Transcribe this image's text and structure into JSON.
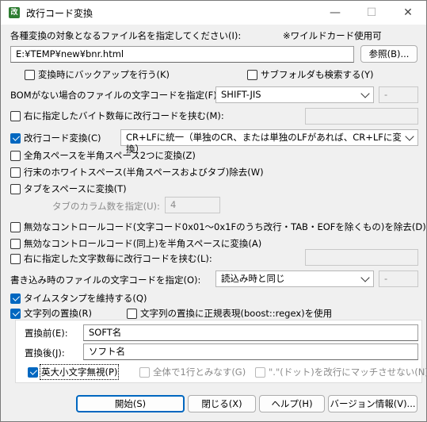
{
  "window": {
    "title": "改行コード変換",
    "icon_text": "改",
    "minimize": "—",
    "maximize": "☐",
    "close": "✕"
  },
  "files": {
    "label": "各種変換の対象となるファイル名を指定してください(I):",
    "wildcard_note": "※ワイルドカード使用可",
    "path_value": "E:¥TEMP¥new¥bnr.html",
    "browse_label": "参照(B)..."
  },
  "options": {
    "backup_label": "変換時にバックアップを行う(K)",
    "backup_checked": false,
    "subfolder_label": "サブフォルダも検索する(Y)",
    "subfolder_checked": false,
    "bom_label": "BOMがない場合のファイルの文字コードを指定(F):",
    "bom_value": "SHIFT-JIS",
    "bom_side_value": "-",
    "insert_bytes_label": "右に指定したバイト数毎に改行コードを挟む(M):",
    "insert_bytes_checked": false,
    "newline_label": "改行コード変換(C)",
    "newline_checked": true,
    "newline_value": "CR+LFに統一（単独のCR、または単独のLFがあれば、CR+LFに変換）",
    "zenkaku_label": "全角スペースを半角スペース2つに変換(Z)",
    "zenkaku_checked": false,
    "trailing_ws_label": "行末のホワイトスペース(半角スペースおよびタブ)除去(W)",
    "trailing_ws_checked": false,
    "tab_label": "タブをスペースに変換(T)",
    "tab_checked": false,
    "tab_width_label": "タブのカラム数を指定(U):",
    "tab_width_value": "4",
    "ctrl_remove_label": "無効なコントロールコード(文字コード0x01〜0x1Fのうち改行・TAB・EOFを除くもの)を除去(D)",
    "ctrl_remove_checked": false,
    "ctrl_space_label": "無効なコントロールコード(同上)を半角スペースに変換(A)",
    "ctrl_space_checked": false,
    "insert_chars_label": "右に指定した文字数毎に改行コードを挟む(L):",
    "insert_chars_checked": false,
    "write_enc_label": "書き込み時のファイルの文字コードを指定(O):",
    "write_enc_value": "読込み時と同じ",
    "write_enc_side_value": "-",
    "timestamp_label": "タイムスタンプを維持する(Q)",
    "timestamp_checked": true,
    "replace_label": "文字列の置換(R)",
    "replace_checked": true,
    "regex_label": "文字列の置換に正規表現(boost::regex)を使用",
    "regex_checked": false
  },
  "replace": {
    "before_label": "置換前(E):",
    "before_value": "SOFT名",
    "after_label": "置換後(J):",
    "after_value": "ソフト名",
    "ignore_case_label": "英大小文字無視(P)",
    "ignore_case_checked": true,
    "whole_line_label": "全体で1行とみなす(G)",
    "whole_line_checked": false,
    "dot_newline_label": "\".\"(ドット)を改行にマッチさせない(N)",
    "dot_newline_checked": false
  },
  "buttons": {
    "start": "開始(S)",
    "close": "閉じる(X)",
    "help": "ヘルプ(H)",
    "version": "バージョン情報(V)..."
  }
}
